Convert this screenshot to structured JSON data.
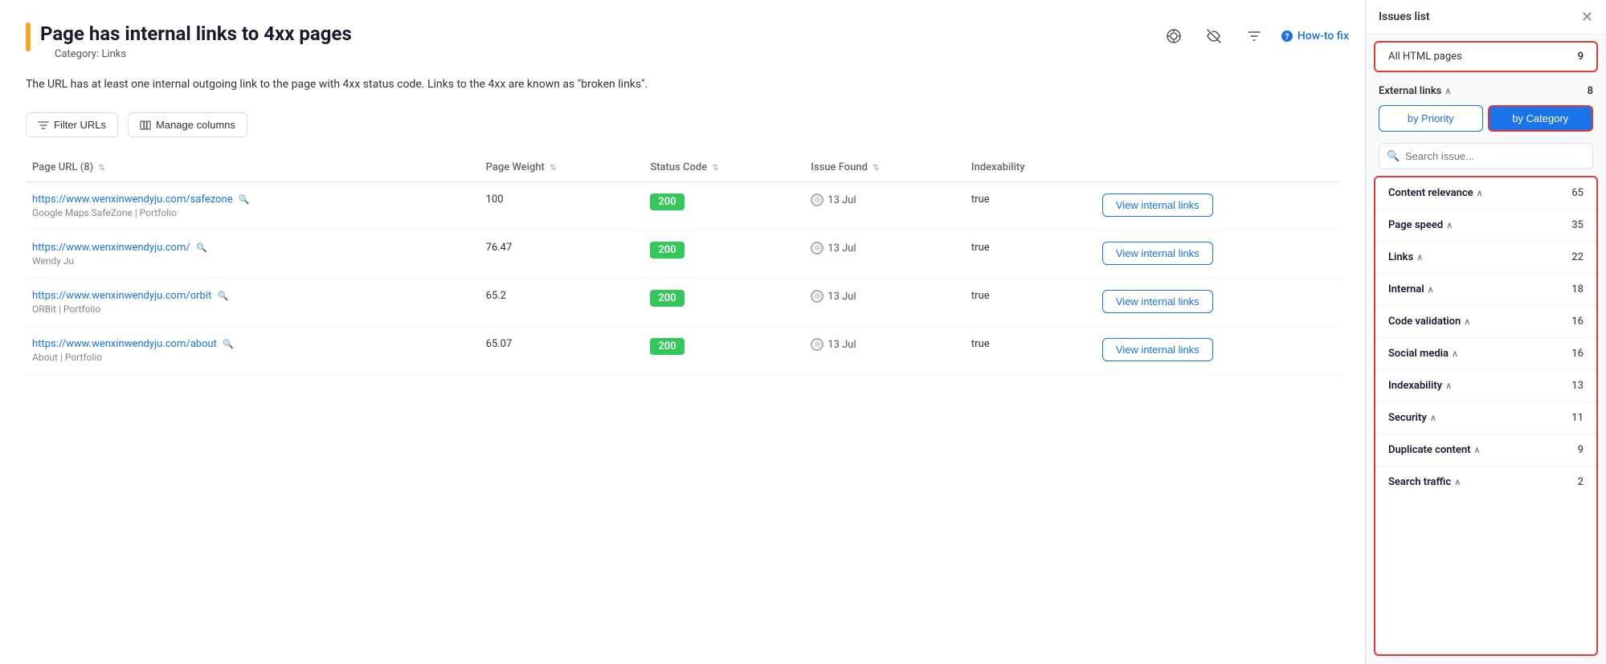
{
  "page": {
    "title": "Page has internal links to 4xx pages",
    "category_prefix": "Category:",
    "category": "Links",
    "description": "The URL has at least one internal outgoing link to the page with 4xx status code. Links to the 4xx are known as \"broken links\".",
    "toolbar": {
      "filter_label": "Filter URLs",
      "manage_columns_label": "Manage columns"
    },
    "how_to_fix": "How-to fix",
    "table": {
      "columns": [
        {
          "label": "Page URL (8)",
          "has_sort": true
        },
        {
          "label": "Page Weight",
          "has_sort": true
        },
        {
          "label": "Status Code",
          "has_sort": true
        },
        {
          "label": "Issue Found",
          "has_sort": true
        },
        {
          "label": "Indexability",
          "has_sort": false
        }
      ],
      "rows": [
        {
          "url": "https://www.wenxinwendyju.com/safezone",
          "subtitle": "Google Maps SafeZone | Portfolio",
          "page_weight": "100",
          "status_code": "200",
          "issue_found": "13 Jul",
          "indexability": "true",
          "action": "View internal links"
        },
        {
          "url": "https://www.wenxinwendyju.com/",
          "subtitle": "Wendy Ju",
          "page_weight": "76.47",
          "status_code": "200",
          "issue_found": "13 Jul",
          "indexability": "true",
          "action": "View internal links"
        },
        {
          "url": "https://www.wenxinwendyju.com/orbit",
          "subtitle": "ORBit | Portfolio",
          "page_weight": "65.2",
          "status_code": "200",
          "issue_found": "13 Jul",
          "indexability": "true",
          "action": "View internal links"
        },
        {
          "url": "https://www.wenxinwendyju.com/about",
          "subtitle": "About | Portfolio",
          "page_weight": "65.07",
          "status_code": "200",
          "issue_found": "13 Jul",
          "indexability": "true",
          "action": "View internal links"
        }
      ]
    }
  },
  "sidebar": {
    "panel_title": "Issues list",
    "all_pages_label": "All HTML pages",
    "all_pages_count": "9",
    "external_links_label": "External links",
    "external_links_count": "8",
    "by_priority_label": "by Priority",
    "by_category_label": "by Category",
    "search_placeholder": "Search issue...",
    "categories": [
      {
        "label": "Content relevance",
        "count": "65"
      },
      {
        "label": "Page speed",
        "count": "35"
      },
      {
        "label": "Links",
        "count": "22"
      },
      {
        "label": "Internal",
        "count": "18"
      },
      {
        "label": "Code validation",
        "count": "16"
      },
      {
        "label": "Social media",
        "count": "16"
      },
      {
        "label": "Indexability",
        "count": "13"
      },
      {
        "label": "Security",
        "count": "11"
      },
      {
        "label": "Duplicate content",
        "count": "9"
      },
      {
        "label": "Search traffic",
        "count": "2"
      }
    ]
  },
  "icons": {
    "close": "✕",
    "filter": "⊟",
    "columns": "≡",
    "search": "🔍",
    "chevron_down": "∨",
    "circle": "◎",
    "target": "⊙",
    "eyeoff": "⊘",
    "funnel": "⊟",
    "question": "?"
  }
}
